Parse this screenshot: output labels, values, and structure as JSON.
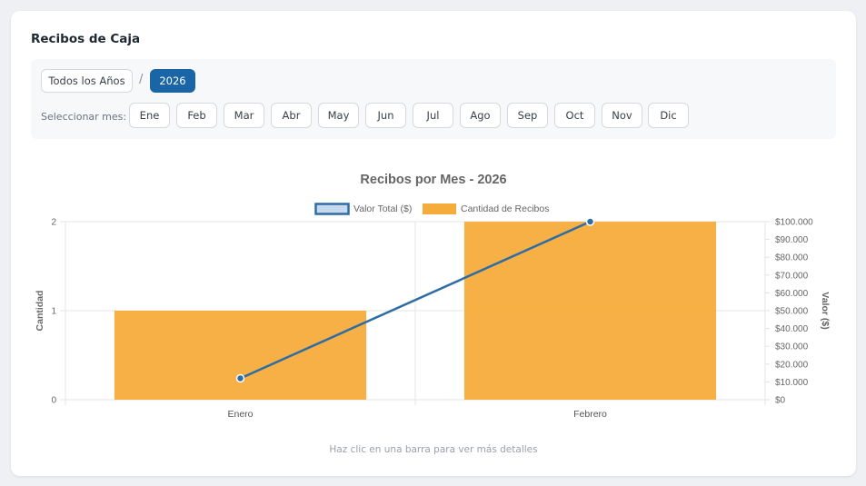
{
  "card": {
    "title": "Recibos de Caja",
    "footer_note": "Haz clic en una barra para ver más detalles"
  },
  "filters": {
    "all_years_label": "Todos los Años",
    "separator": "/",
    "year_label": "2026",
    "month_prompt": "Seleccionar mes:",
    "months": [
      "Ene",
      "Feb",
      "Mar",
      "Abr",
      "May",
      "Jun",
      "Jul",
      "Ago",
      "Sep",
      "Oct",
      "Nov",
      "Dic"
    ]
  },
  "colors": {
    "accent": "#1a65a6",
    "bar": "#f5ac3b",
    "line": "#2e6da4"
  },
  "chart_data": {
    "type": "bar",
    "title": "Recibos por Mes - 2026",
    "categories": [
      "Enero",
      "Febrero"
    ],
    "series": [
      {
        "name": "Cantidad de Recibos",
        "type": "bar",
        "axis": "left",
        "values": [
          1,
          2
        ]
      },
      {
        "name": "Valor Total ($)",
        "type": "line",
        "axis": "right",
        "values": [
          12000,
          100000
        ]
      }
    ],
    "ylabel": "Cantidad",
    "ylabel_right": "Valor ($)",
    "ylim": [
      0,
      2
    ],
    "ylim_right": [
      0,
      100000
    ],
    "y_ticks": [
      "0",
      "1",
      "2"
    ],
    "y_ticks_right": [
      "$0",
      "$10.000",
      "$20.000",
      "$30.000",
      "$40.000",
      "$50.000",
      "$60.000",
      "$70.000",
      "$80.000",
      "$90.000",
      "$100.000"
    ],
    "legend_position": "top",
    "grid": true
  }
}
